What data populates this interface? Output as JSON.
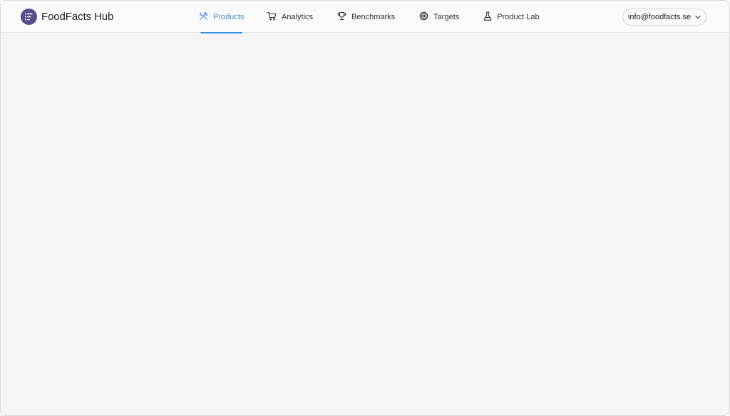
{
  "app": {
    "name": "FoodFacts Hub"
  },
  "nav": {
    "items": [
      {
        "label": "Products",
        "icon": "utensils-icon",
        "active": true
      },
      {
        "label": "Analytics",
        "icon": "shopping-cart-icon",
        "active": false
      },
      {
        "label": "Benchmarks",
        "icon": "trophy-icon",
        "active": false
      },
      {
        "label": "Targets",
        "icon": "target-icon",
        "active": false
      },
      {
        "label": "Product Lab",
        "icon": "flask-icon",
        "active": false
      }
    ]
  },
  "account": {
    "email": "info@foodfacts.se",
    "icon": "chevron-down-icon"
  },
  "colors": {
    "accent": "#3b8fd6",
    "logo": "#5a4d8c",
    "background": "#f5f5f5"
  }
}
